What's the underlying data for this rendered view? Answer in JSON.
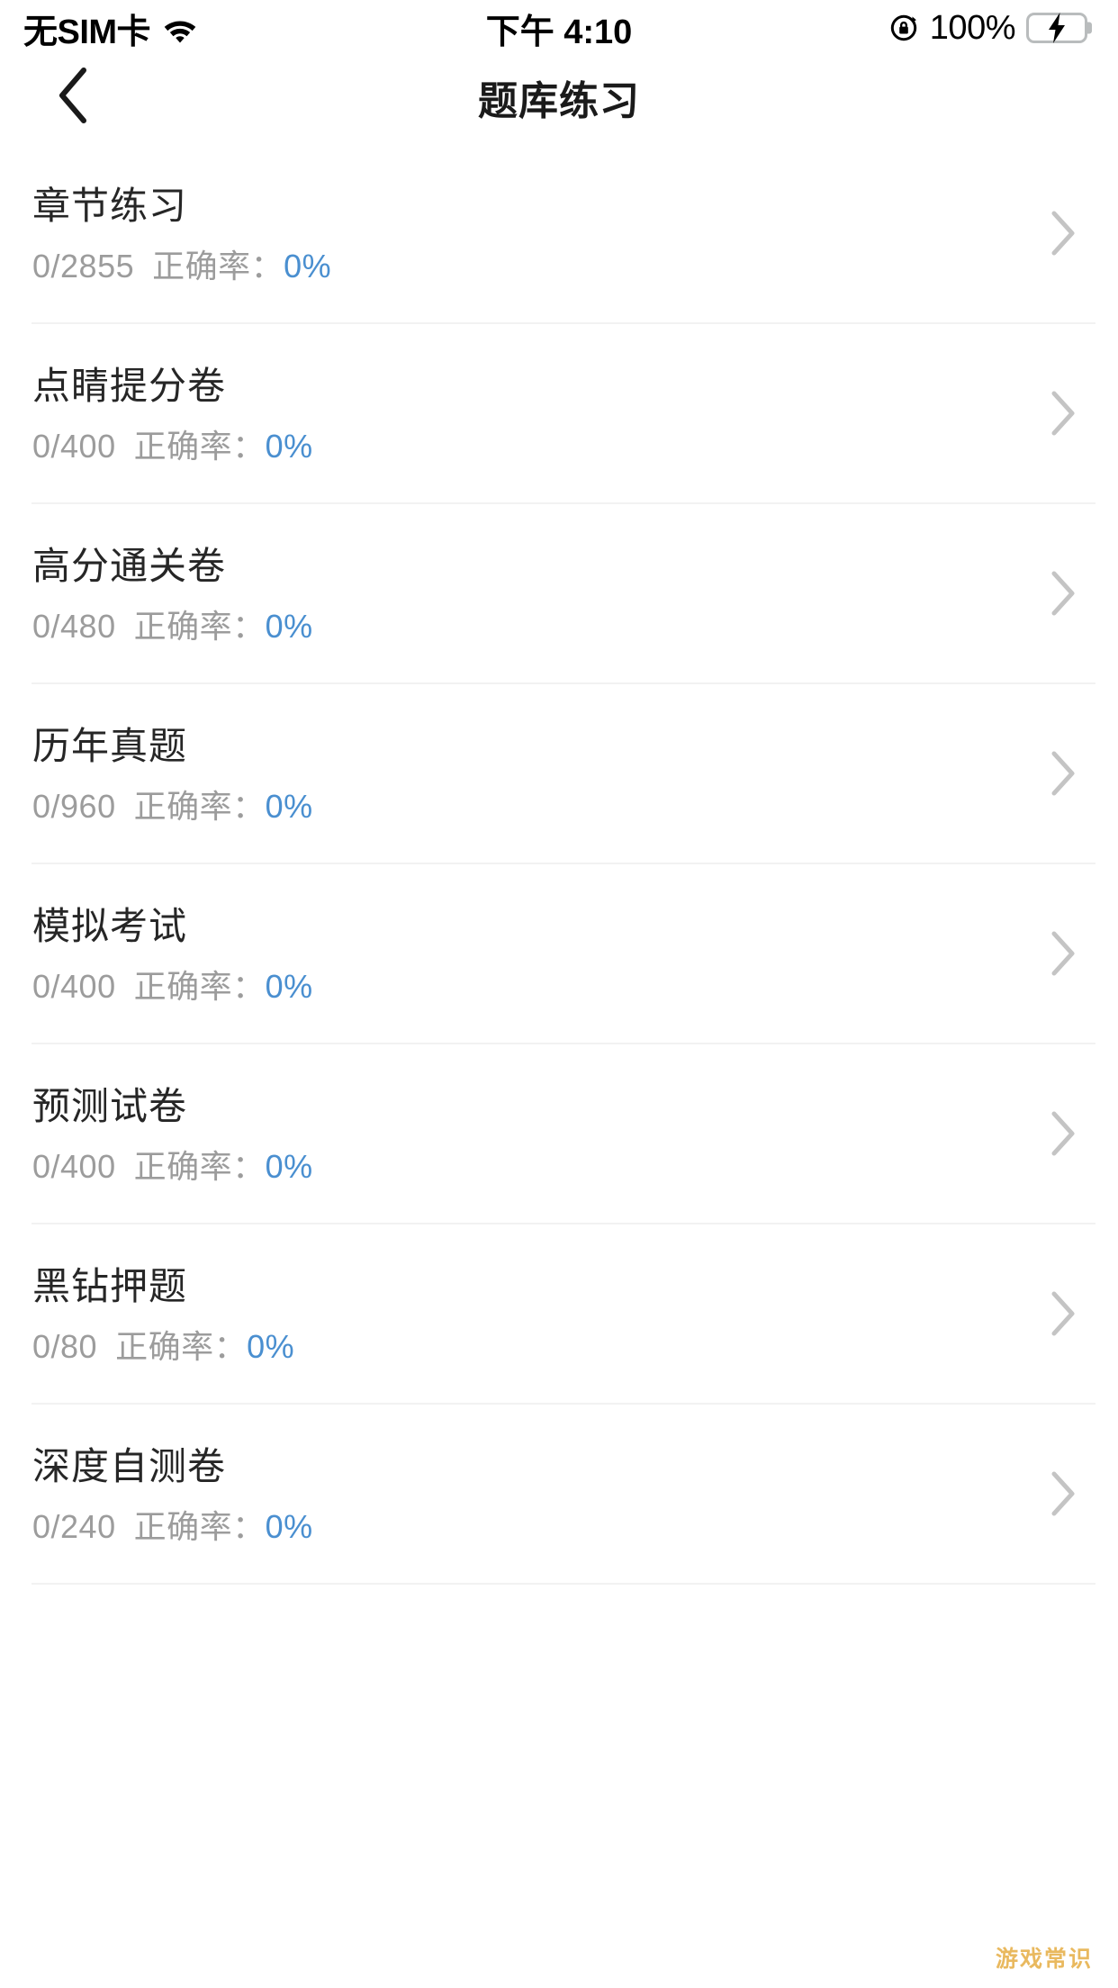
{
  "status_bar": {
    "carrier": "无SIM卡",
    "wifi_icon": "wifi-icon",
    "time": "下午 4:10",
    "rotation_lock_icon": "rotation-lock-icon",
    "battery_percent": "100%",
    "battery_icon": "battery-charging-icon",
    "battery_color": "#2ed04a"
  },
  "nav": {
    "back_icon": "chevron-left-icon",
    "title": "题库练习"
  },
  "theme": {
    "accent_blue": "#4a8fd0",
    "title_color": "#262626",
    "sub_color": "#9c9c9c",
    "divider_color": "#f2f2f2"
  },
  "list": {
    "chevron_icon": "chevron-right-icon",
    "rate_label": "正确率：",
    "items": [
      {
        "title": "章节练习",
        "count": "0/2855",
        "rate_label": "正确率：",
        "rate": "0%"
      },
      {
        "title": "点睛提分卷",
        "count": "0/400",
        "rate_label": "正确率：",
        "rate": "0%"
      },
      {
        "title": "高分通关卷",
        "count": "0/480",
        "rate_label": "正确率：",
        "rate": "0%"
      },
      {
        "title": "历年真题",
        "count": "0/960",
        "rate_label": "正确率：",
        "rate": "0%"
      },
      {
        "title": "模拟考试",
        "count": "0/400",
        "rate_label": "正确率：",
        "rate": "0%"
      },
      {
        "title": "预测试卷",
        "count": "0/400",
        "rate_label": "正确率：",
        "rate": "0%"
      },
      {
        "title": "黑钻押题",
        "count": "0/80",
        "rate_label": "正确率：",
        "rate": "0%"
      },
      {
        "title": "深度自测卷",
        "count": "0/240",
        "rate_label": "正确率：",
        "rate": "0%"
      }
    ]
  },
  "watermark": {
    "text": "游戏常识",
    "color": "#e8b657"
  }
}
